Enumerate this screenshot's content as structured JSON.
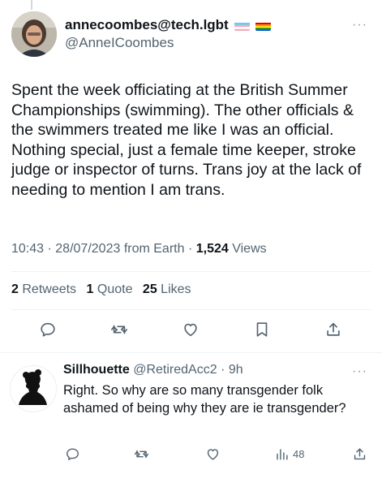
{
  "main_tweet": {
    "display_name": "annecoombes@tech.lgbt",
    "handle": "@AnneICoombes",
    "text": "Spent the week officiating at the British Summer Championships (swimming). The other officials & the swimmers treated me like I was an official. Nothing special, just a female time keeper, stroke judge or inspector of turns. Trans joy at the lack of needing to mention I am trans.",
    "time": "10:43",
    "date": "28/07/2023",
    "source": "from Earth",
    "views_count": "1,524",
    "views_label": "Views",
    "retweets_count": "2",
    "retweets_label": "Retweets",
    "quotes_count": "1",
    "quotes_label": "Quote",
    "likes_count": "25",
    "likes_label": "Likes"
  },
  "reply": {
    "display_name": "Sillhouette",
    "handle": "@RetiredAcc2",
    "age": "9h",
    "text": "Right. So why are so many transgender folk ashamed of being why they are ie transgender?",
    "views_count": "48"
  },
  "icons": {
    "reply": "reply-icon",
    "retweet": "retweet-icon",
    "like": "like-icon",
    "bookmark": "bookmark-icon",
    "share": "share-icon",
    "views": "views-icon",
    "more": "more-icon"
  },
  "colors": {
    "text_primary": "#0f1419",
    "text_secondary": "#536471",
    "divider": "#eff3f4"
  }
}
